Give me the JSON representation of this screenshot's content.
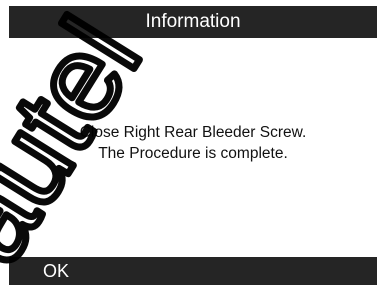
{
  "window": {
    "title": "Information"
  },
  "message": {
    "line1": "Close Right Rear Bleeder Screw.",
    "line2": "The Procedure is complete."
  },
  "footer": {
    "ok_label": "OK"
  },
  "colors": {
    "bar": "#252525",
    "bar_text": "#ffffff",
    "body_background": "#ffffff",
    "body_text": "#111111",
    "watermark": "#000000"
  },
  "watermark": {
    "text": "autel"
  }
}
